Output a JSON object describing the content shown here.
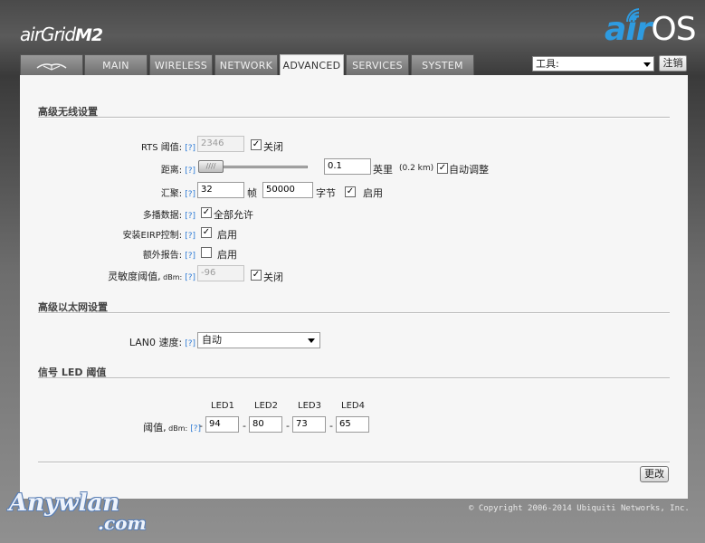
{
  "header": {
    "brand_left_prefix": "airGrid",
    "brand_left_model": "M2",
    "brand_right_air": "air",
    "brand_right_os": "OS"
  },
  "tabs": [
    {
      "label": "",
      "icon": "ubiquiti-logo-icon"
    },
    {
      "label": "MAIN"
    },
    {
      "label": "WIRELESS"
    },
    {
      "label": "NETWORK"
    },
    {
      "label": "ADVANCED",
      "active": true
    },
    {
      "label": "SERVICES"
    },
    {
      "label": "SYSTEM"
    }
  ],
  "toolbar": {
    "tools_selected": "工具:",
    "logout_label": "注销"
  },
  "advanced_wireless": {
    "title": "高级无线设置",
    "help": "[?]",
    "rts": {
      "label": "RTS 阈值:",
      "value": "2346",
      "checkbox_checked": true,
      "checkbox_label": "关闭"
    },
    "distance": {
      "label": "距离:",
      "slider_value": 0.0,
      "value": "0.1",
      "unit": "英里",
      "km": "(0.2 km)",
      "auto_checked": true,
      "auto_label": "自动调整"
    },
    "aggregation": {
      "label": "汇聚:",
      "frames_value": "32",
      "frames_unit": "帧",
      "bytes_value": "50000",
      "bytes_unit": "字节",
      "enable_checked": true,
      "enable_label": "启用"
    },
    "multicast": {
      "label": "多播数据:",
      "checked": true,
      "check_label": "全部允许"
    },
    "eirp": {
      "label": "安装EIRP控制:",
      "checked": true,
      "check_label": "启用"
    },
    "extra_report": {
      "label": "额外报告:",
      "checked": false,
      "check_label": "启用"
    },
    "sensitivity": {
      "label_main": "灵敏度阈值,",
      "label_unit": " dBm:",
      "value": "-96",
      "checkbox_checked": true,
      "checkbox_label": "关闭"
    }
  },
  "advanced_ethernet": {
    "title": "高级以太网设置",
    "lan0": {
      "label": "LAN0 速度:",
      "selected": "自动"
    }
  },
  "led": {
    "title": "信号  LED 阈值",
    "label_main": "阈值,",
    "label_unit": " dBm:",
    "headers": [
      "LED1",
      "LED2",
      "LED3",
      "LED4"
    ],
    "values": [
      "94",
      "80",
      "73",
      "65"
    ],
    "dash": "-"
  },
  "footer": {
    "save_label": "更改",
    "copyright": "© Copyright 2006-2014 Ubiquiti Networks, Inc.",
    "watermark_main": "Anywlan",
    "watermark_com": ".com"
  },
  "colors": {
    "accent_blue": "#2e9be0",
    "help_link": "#2e7bd6"
  }
}
